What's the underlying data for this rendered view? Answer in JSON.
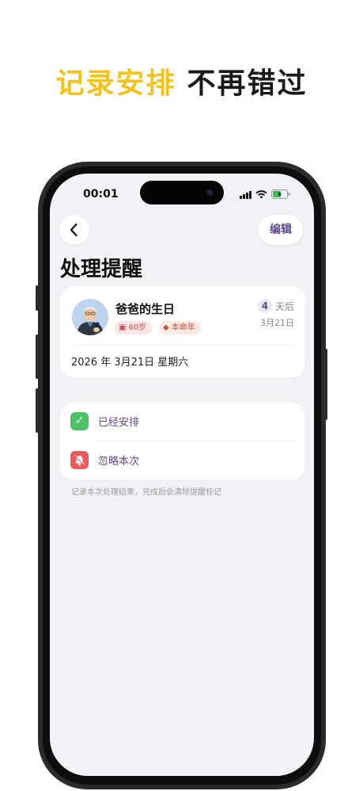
{
  "promo": {
    "highlight": "记录安排",
    "rest": "不再错过"
  },
  "status_bar": {
    "time": "00:01"
  },
  "header": {
    "edit_label": "编辑",
    "page_title": "处理提醒"
  },
  "event": {
    "title": "爸爸的生日",
    "age_badge": "60岁",
    "zodiac_badge": "本命年",
    "days_count": "4",
    "days_unit": "天后",
    "date_short": "3月21日",
    "full_date": "2026 年 3月21日  星期六"
  },
  "options": [
    {
      "label": "已经安排",
      "icon": "check-icon",
      "color": "#4CC267"
    },
    {
      "label": "忽略本次",
      "icon": "bell-off-icon",
      "color": "#EE5A5A"
    }
  ],
  "hint": "记录本次处理结果，完成后会清除提醒标记",
  "colors": {
    "accent_yellow": "#F5C21B",
    "accent_purple": "#5E4A86",
    "screen_bg": "#F2F2F6"
  }
}
